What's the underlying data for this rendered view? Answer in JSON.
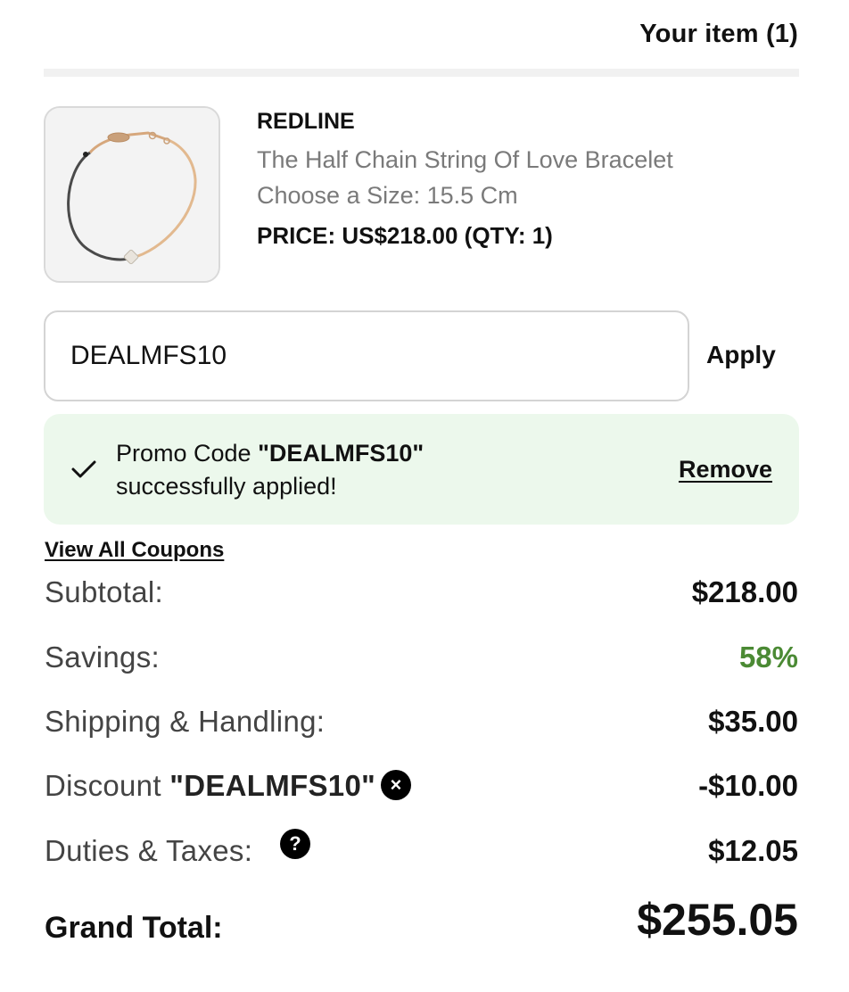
{
  "header": {
    "title": "Your item (1)"
  },
  "item": {
    "image_icon": "bracelet-image",
    "brand": "REDLINE",
    "name": "The Half Chain String Of Love Bracelet",
    "size_text": "Choose a Size: 15.5 Cm",
    "price_text": "PRICE: US$218.00 (QTY: 1)"
  },
  "promo": {
    "input_value": "DEALMFS10",
    "apply_label": "Apply",
    "success_prefix": "Promo Code ",
    "success_code": "\"DEALMFS10\"",
    "success_suffix": "successfully applied!",
    "remove_label": "Remove",
    "view_coupons_label": "View All Coupons",
    "success_bg_color": "#ecf8ec"
  },
  "summary": {
    "subtotal_label": "Subtotal:",
    "subtotal_value": "$218.00",
    "savings_label": "Savings:",
    "savings_value": "58%",
    "savings_color": "#4b8a34",
    "shipping_label": "Shipping & Handling:",
    "shipping_value": "$35.00",
    "discount_label": "Discount ",
    "discount_code": "\"DEALMFS10\"",
    "discount_remove_icon": "×",
    "discount_value": "-$10.00",
    "duties_label": "Duties & Taxes:",
    "duties_help_icon": "?",
    "duties_value": "$12.05",
    "grand_total_label": "Grand Total:",
    "grand_total_value": "$255.05"
  }
}
